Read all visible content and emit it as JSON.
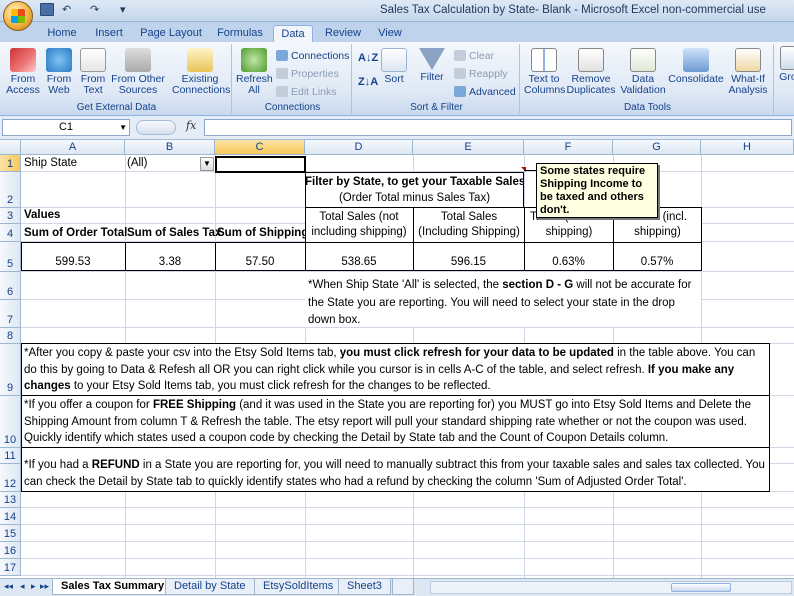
{
  "window": {
    "title": "Sales Tax Calculation by State- Blank - Microsoft Excel non-commercial use"
  },
  "qat": {
    "undo": "↶",
    "redo": "↷",
    "more": "▾"
  },
  "tabs": [
    "Home",
    "Insert",
    "Page Layout",
    "Formulas",
    "Data",
    "Review",
    "View"
  ],
  "active_tab": "Data",
  "ribbon": {
    "get_external": {
      "label": "Get External Data",
      "from_access": "From Access",
      "from_web": "From Web",
      "from_text": "From Text",
      "from_other": "From Other Sources",
      "existing": "Existing Connections"
    },
    "connections": {
      "label": "Connections",
      "refresh": "Refresh All",
      "connections": "Connections",
      "properties": "Properties",
      "edit_links": "Edit Links"
    },
    "sort_filter": {
      "label": "Sort & Filter",
      "sort": "Sort",
      "filter": "Filter",
      "clear": "Clear",
      "reapply": "Reapply",
      "advanced": "Advanced"
    },
    "data_tools": {
      "label": "Data Tools",
      "text_to_columns": "Text to Columns",
      "remove_duplicates": "Remove Duplicates",
      "data_validation": "Data Validation",
      "consolidate": "Consolidate",
      "what_if": "What-If Analysis"
    },
    "outline": {
      "group": "Gro"
    }
  },
  "formula_bar": {
    "name_box": "C1",
    "fx": "fx",
    "content": ""
  },
  "columns": [
    "A",
    "B",
    "C",
    "D",
    "E",
    "F",
    "G",
    "H"
  ],
  "rows": [
    "1",
    "2",
    "3",
    "4",
    "5",
    "6",
    "7",
    "8",
    "9",
    "10",
    "11",
    "12",
    "13",
    "14",
    "15",
    "16",
    "17"
  ],
  "cells": {
    "a1": "Ship State",
    "b1": "(All)",
    "d2_line1": "Filter by State, to get your Taxable Sales",
    "d2_line2": "(Order Total minus Sales Tax)",
    "a3": "Values",
    "a4": "Sum of Order Total",
    "b4": "Sum of Sales Tax",
    "c4": "Sum of Shipping",
    "d34": "Total Sales (not including shipping)",
    "e34": "Total Sales (Including Shipping)",
    "f34": "Tax % (not incl. shipping)",
    "g34": "Tax % (incl. shipping)",
    "a5": "599.53",
    "b5": "3.38",
    "c5": "57.50",
    "d5": "538.65",
    "e5": "596.15",
    "f5": "0.63%",
    "g5": "0.57%",
    "note_d6_pre": "*When Ship State 'All' is selected, the ",
    "note_d6_bold": "section D - G",
    "note_d6_post": " will not be accurate for the State you are reporting.  You will need to select your state in the drop down box.",
    "note9_a": "*After you copy & paste your csv into the Etsy Sold Items tab, ",
    "note9_b": "you must click refresh for your data to be updated",
    "note9_c": " in the table above.  You can do this by going to Data & Refesh all OR you can right click while you cursor is in cells A-C of the table, and select refresh.  ",
    "note9_d": "If you make any changes",
    "note9_e": " to your Etsy Sold Items tab, you must click refresh for the changes to be reflected.",
    "note10_a": "*If you offer a coupon for ",
    "note10_b": "FREE Shipping",
    "note10_c": " (and it was used in the State you are reporting for) you MUST go into Etsy Sold Items and Delete the Shipping Amount from column T & Refresh the table.  The etsy report will pull your standard shipping rate whether or not the coupon was used.  Quickly identify which states used a coupon code by checking the Detail by State tab and the Count of Coupon Details column.",
    "note12_a": "*If you had a ",
    "note12_b": "REFUND",
    "note12_c": " in a State you are reporting for, you will need to manually subtract this from your taxable sales and sales tax collected.  You can check the Detail by State tab to quickly identify states who had a refund by checking the column 'Sum of Adjusted Order Total'."
  },
  "comment": {
    "text": "Some states require Shipping Income to be taxed and others don't."
  },
  "sheet_tabs": [
    "Sales Tax Summary",
    "Detail by State",
    "EtsySoldItems",
    "Sheet3"
  ],
  "active_sheet": "Sales Tax Summary",
  "sheet_nav": [
    "◂◂",
    "◂",
    "▸",
    "▸▸"
  ]
}
